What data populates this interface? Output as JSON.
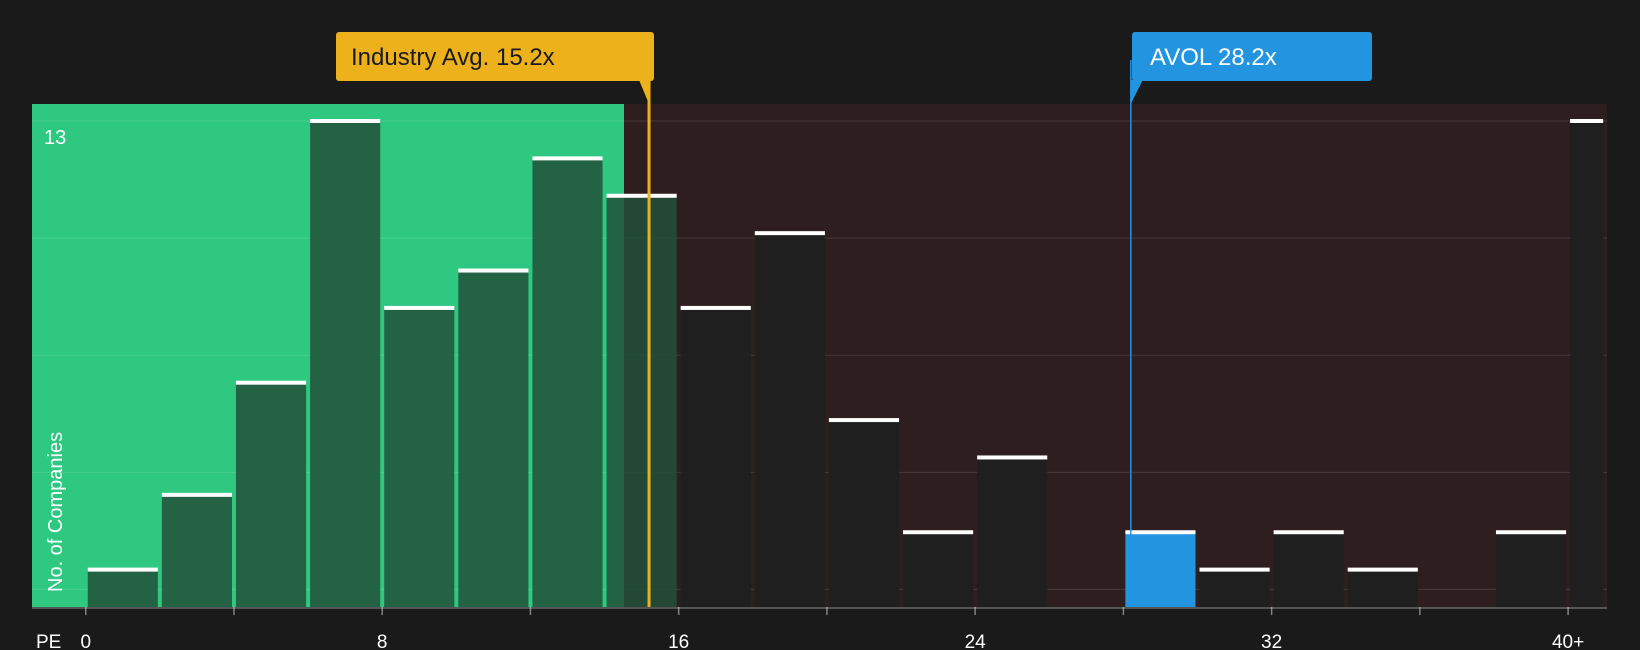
{
  "chart_data": {
    "type": "bar",
    "x_axis": {
      "label": "PE",
      "ticks": [
        "0",
        "8",
        "16",
        "24",
        "32",
        "40+"
      ]
    },
    "y_axis": {
      "label": "No. of Companies",
      "max_label": "13",
      "ylim": [
        0,
        13
      ]
    },
    "bins": [
      {
        "x_start": 0,
        "x_end": 2,
        "value": 1
      },
      {
        "x_start": 2,
        "x_end": 4,
        "value": 3
      },
      {
        "x_start": 4,
        "x_end": 6,
        "value": 6
      },
      {
        "x_start": 6,
        "x_end": 8,
        "value": 13
      },
      {
        "x_start": 8,
        "x_end": 10,
        "value": 8
      },
      {
        "x_start": 10,
        "x_end": 12,
        "value": 9
      },
      {
        "x_start": 12,
        "x_end": 14,
        "value": 12
      },
      {
        "x_start": 14,
        "x_end": 16,
        "value": 11
      },
      {
        "x_start": 16,
        "x_end": 18,
        "value": 8
      },
      {
        "x_start": 18,
        "x_end": 20,
        "value": 10
      },
      {
        "x_start": 20,
        "x_end": 22,
        "value": 5
      },
      {
        "x_start": 22,
        "x_end": 24,
        "value": 2
      },
      {
        "x_start": 24,
        "x_end": 26,
        "value": 4
      },
      {
        "x_start": 26,
        "x_end": 28,
        "value": 0
      },
      {
        "x_start": 28,
        "x_end": 30,
        "value": 2,
        "highlight": true
      },
      {
        "x_start": 30,
        "x_end": 32,
        "value": 1
      },
      {
        "x_start": 32,
        "x_end": 34,
        "value": 2
      },
      {
        "x_start": 34,
        "x_end": 36,
        "value": 1
      },
      {
        "x_start": 36,
        "x_end": 38,
        "value": 0
      },
      {
        "x_start": 38,
        "x_end": 40,
        "value": 2
      },
      {
        "x_start": 40,
        "x_end": 41,
        "value": 13
      }
    ],
    "x_domain": [
      -1.45,
      41.05
    ],
    "industry_avg": {
      "value": 15.2,
      "label": "Industry Avg. 15.2x"
    },
    "company": {
      "name": "AVOL",
      "value": 28.2,
      "label": "AVOL 28.2x"
    },
    "grid": true
  },
  "colors": {
    "background": "#1a1a1a",
    "undervalued_zone": "#2ec880",
    "overvalued_zone": "#2e1e1f",
    "bar_dark": "#202020",
    "bar_green": "#22503a",
    "bar_cap": "#ffffff",
    "industry_accent": "#edb21b",
    "company_accent": "#2394e0"
  }
}
